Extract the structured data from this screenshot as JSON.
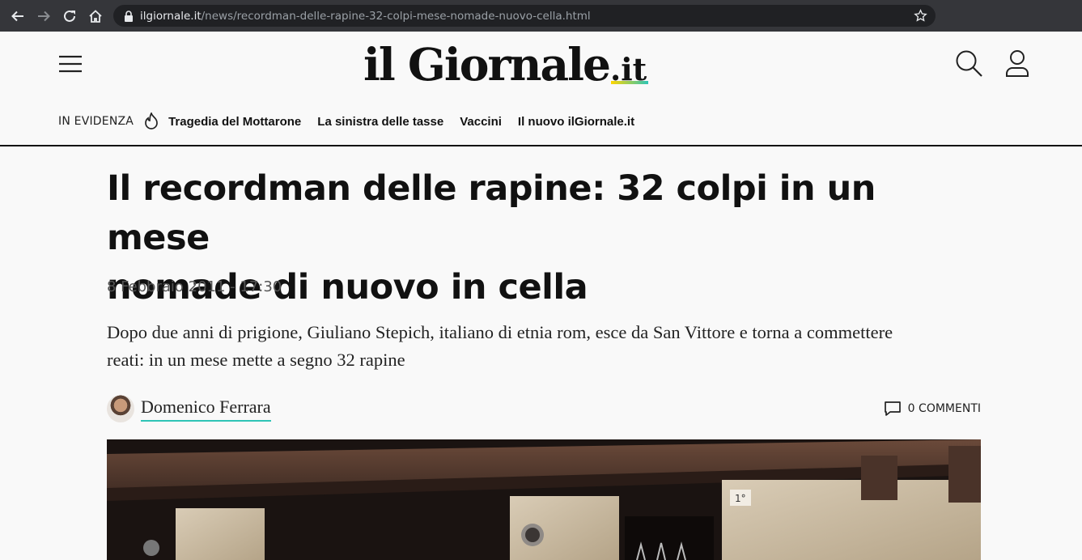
{
  "browser": {
    "url_host": "ilgiornale.it",
    "url_path": "/news/recordman-delle-rapine-32-colpi-mese-nomade-nuovo-cella.html",
    "icons": [
      "back-icon",
      "forward-icon",
      "reload-icon",
      "home-icon",
      "lock-icon",
      "star-icon"
    ]
  },
  "header": {
    "logo_main": "il Giornale",
    "logo_tld": ".it",
    "icons": [
      "menu-icon",
      "search-icon",
      "user-icon",
      "flame-icon"
    ],
    "trending_label": "IN EVIDENZA",
    "trending_links": [
      "Tragedia del Mottarone",
      "La sinistra delle tasse",
      "Vaccini",
      "Il nuovo ilGiornale.it"
    ]
  },
  "article": {
    "title_line1": "Il recordman delle rapine: 32 colpi in un mese",
    "title_line2": "nomade di nuovo in cella",
    "date": "8 Febbraio 2011 - 17:30",
    "summary": "Dopo due anni di prigione, Giuliano Stepich, italiano di etnia rom, esce da San Vittore e torna a commettere reati: in un mese mette a segno 32 rapine",
    "author": "Domenico Ferrara",
    "comments_count": "0",
    "comments_label": "COMMENTI",
    "image_sign": "1°"
  },
  "colors": {
    "accent_teal": "#2ec4b6",
    "accent_yellow": "#ffd600",
    "browser_bar": "#35363a"
  }
}
